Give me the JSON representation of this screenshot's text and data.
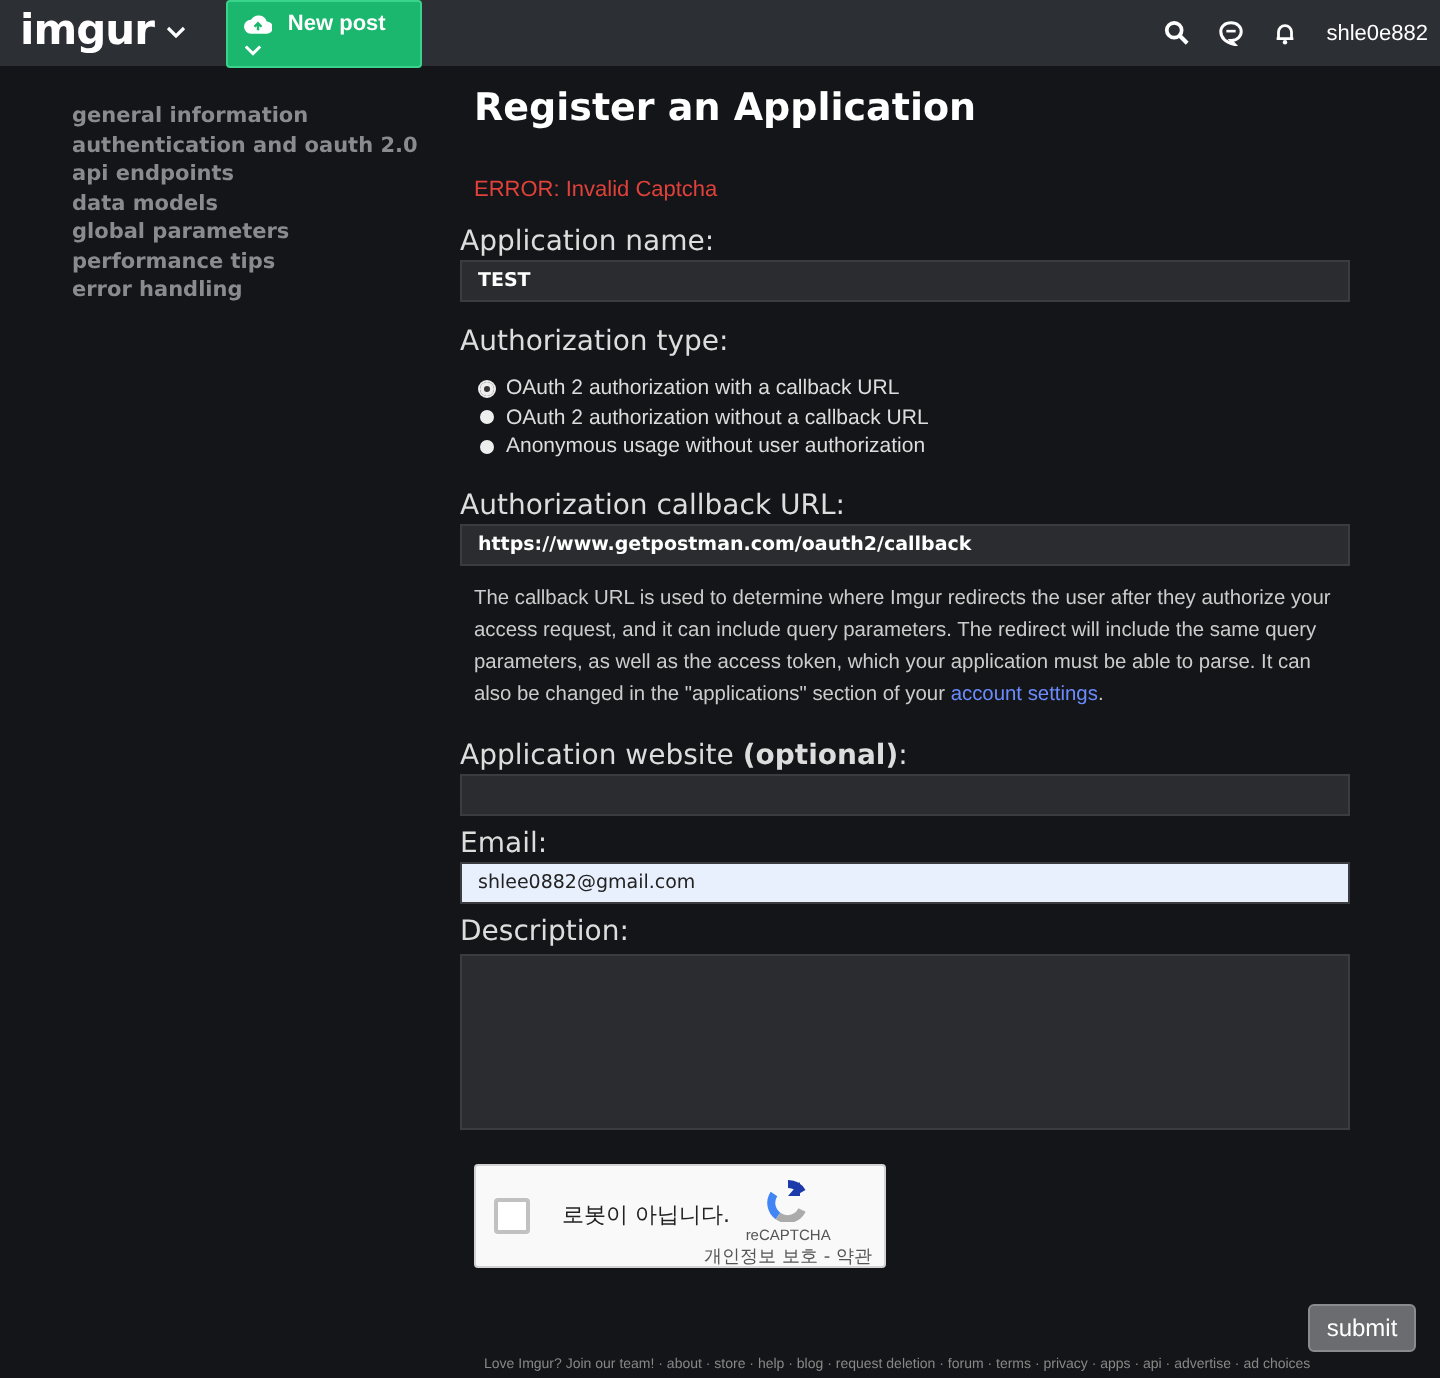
{
  "header": {
    "logo": "imgur",
    "new_post": "New post",
    "username": "shle0e882"
  },
  "sidebar": {
    "items": [
      {
        "label": "general information"
      },
      {
        "label": "authentication and oauth 2.0"
      },
      {
        "label": "api endpoints"
      },
      {
        "label": "data models"
      },
      {
        "label": "global parameters"
      },
      {
        "label": "performance tips"
      },
      {
        "label": "error handling"
      }
    ]
  },
  "form": {
    "title": "Register an Application",
    "error": "ERROR: Invalid Captcha",
    "app_name": {
      "label": "Application name:",
      "value": "TEST"
    },
    "auth_type": {
      "label": "Authorization type:",
      "options": [
        {
          "label": "OAuth 2 authorization with a callback URL",
          "selected": true
        },
        {
          "label": "OAuth 2 authorization without a callback URL",
          "selected": false
        },
        {
          "label": "Anonymous usage without user authorization",
          "selected": false
        }
      ]
    },
    "callback": {
      "label": "Authorization callback URL:",
      "value": "https://www.getpostman.com/oauth2/callback"
    },
    "help": {
      "text": "The callback URL is used to determine where Imgur redirects the user after they authorize your access request, and it can include query parameters. The redirect will include the same query parameters, as well as the access token, which your application must be able to parse. It can also be changed in the \"applications\" section of your ",
      "link": "account settings",
      "end": "."
    },
    "website": {
      "label": "Application website **(optional)**:"
    },
    "email": {
      "label": "Email:",
      "value": "shlee0882@gmail.com"
    },
    "description": {
      "label": "Description:"
    },
    "captcha": {
      "checked": false,
      "label": "로봇이 아닙니다.",
      "brand": "reCAPTCHA",
      "links": "개인정보 보호 - 약관"
    },
    "submit": "submit"
  },
  "footer": {
    "links": "Love Imgur? Join our team! · about · store · help · blog · request deletion · forum · terms · privacy · apps · api · advertise · ad choices"
  }
}
